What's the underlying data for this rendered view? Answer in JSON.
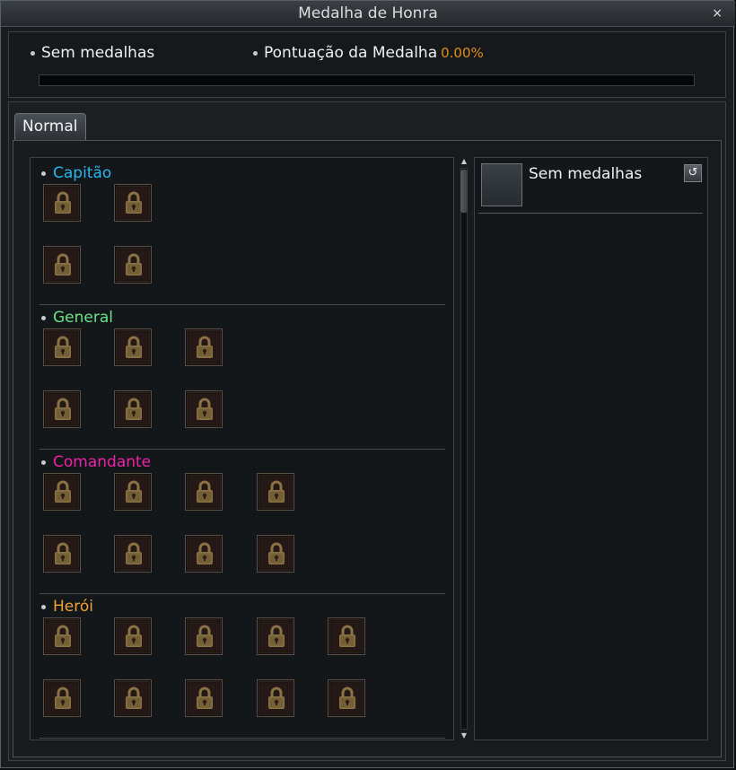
{
  "window": {
    "title": "Medalha de Honra",
    "close_label": "×"
  },
  "summary": {
    "medals_status": "Sem medalhas",
    "score_label": "Pontuação da Medalha",
    "score_percent": "0.00%",
    "progress_fraction": 0
  },
  "tabs": [
    {
      "label": "Normal",
      "active": true
    }
  ],
  "categories": [
    {
      "name": "Capitão",
      "color": "#27b6ee",
      "rows": [
        2,
        2
      ],
      "icon": "lock-icon"
    },
    {
      "name": "General",
      "color": "#6ae287",
      "rows": [
        3,
        3
      ],
      "icon": "lock-icon"
    },
    {
      "name": "Comandante",
      "color": "#ee22a9",
      "rows": [
        4,
        4
      ],
      "icon": "lock-icon"
    },
    {
      "name": "Herói",
      "color": "#f0a13a",
      "rows": [
        5,
        5
      ],
      "icon": "lock-icon"
    }
  ],
  "details": {
    "selected_label": "Sem medalhas",
    "reset_icon": "refresh-icon"
  },
  "colors": {
    "accent": "#e28c1b",
    "medal_frame": "#5a5046"
  }
}
